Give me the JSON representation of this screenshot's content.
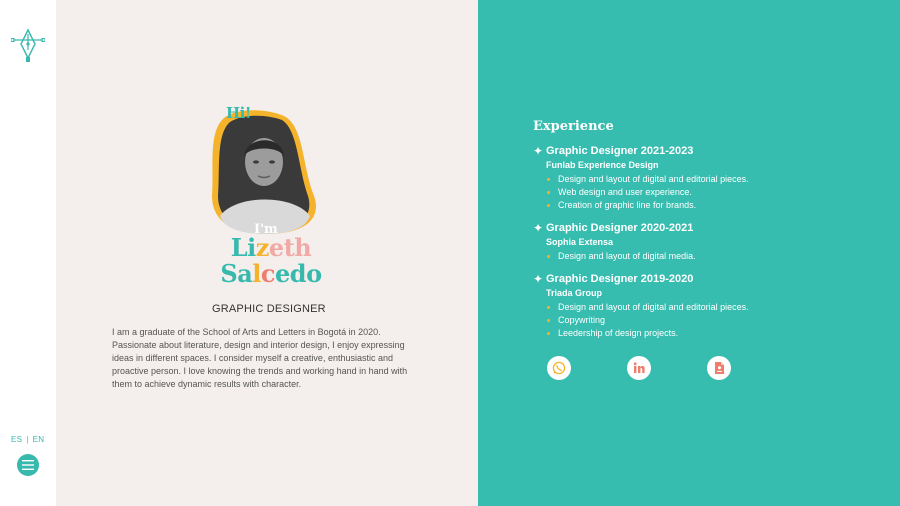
{
  "sidebar": {
    "logo_icon": "pen-nib-icon",
    "lang_es": "ES",
    "lang_sep": "|",
    "lang_en": "EN",
    "menu_icon": "hamburger-menu-icon"
  },
  "profile": {
    "greeting": "Hi!",
    "intro": "I'm",
    "first_name": [
      "Li",
      "z",
      "e",
      "th"
    ],
    "last_name": [
      "Sa",
      "l",
      "c",
      "edo"
    ],
    "role": "GRAPHIC DESIGNER",
    "bio": "I am a graduate of the School of Arts and Letters in Bogotá in 2020. Passionate about literature, design and interior design, I enjoy expressing ideas in different spaces. I consider myself a creative, enthusiastic and proactive person. I love knowing the trends and working hand in hand with them to achieve dynamic results with character."
  },
  "experience": {
    "title": "Experience",
    "jobs": [
      {
        "title": "Graphic Designer 2021-2023",
        "company": "Funlab Experience Design",
        "items": [
          "Design and layout of digital and editorial pieces.",
          "Web design and user experience.",
          "Creation of graphic line for brands."
        ]
      },
      {
        "title": "Graphic Designer 2020-2021",
        "company": "Sophia Extensa",
        "items": [
          "Design and layout of digital media."
        ]
      },
      {
        "title": "Graphic Designer 2019-2020",
        "company": "Triada Group",
        "items": [
          "Design and layout of digital and editorial pieces.",
          "Copywriting",
          "Leedership of design projects."
        ]
      }
    ]
  },
  "social": {
    "whatsapp_icon": "whatsapp-icon",
    "linkedin_icon": "linkedin-icon",
    "cv_icon": "cv-document-icon"
  },
  "colors": {
    "teal": "#37bdaf",
    "cream": "#f4eeec",
    "yellow": "#f5b32c",
    "pink": "#f0a9a4",
    "coral": "#ee7e6b"
  }
}
